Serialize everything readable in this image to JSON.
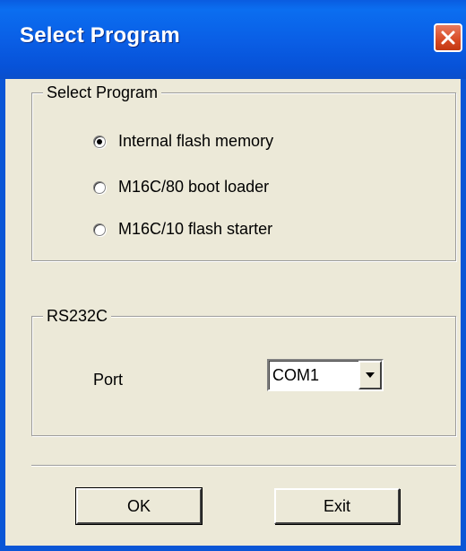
{
  "window": {
    "title": "Select Program",
    "close_icon": "close-x-icon"
  },
  "program_group": {
    "legend": "Select Program",
    "options": [
      {
        "label": "Internal flash memory",
        "checked": true
      },
      {
        "label": "M16C/80 boot loader",
        "checked": false
      },
      {
        "label": "M16C/10 flash starter",
        "checked": false
      }
    ]
  },
  "rs232c_group": {
    "legend": "RS232C",
    "port_label": "Port",
    "port_value": "COM1"
  },
  "buttons": {
    "ok_label": "OK",
    "exit_label": "Exit"
  },
  "colors": {
    "titlebar": "#0a5fe6",
    "dialog_bg": "#ece9d8",
    "close_button": "#d84a24"
  }
}
